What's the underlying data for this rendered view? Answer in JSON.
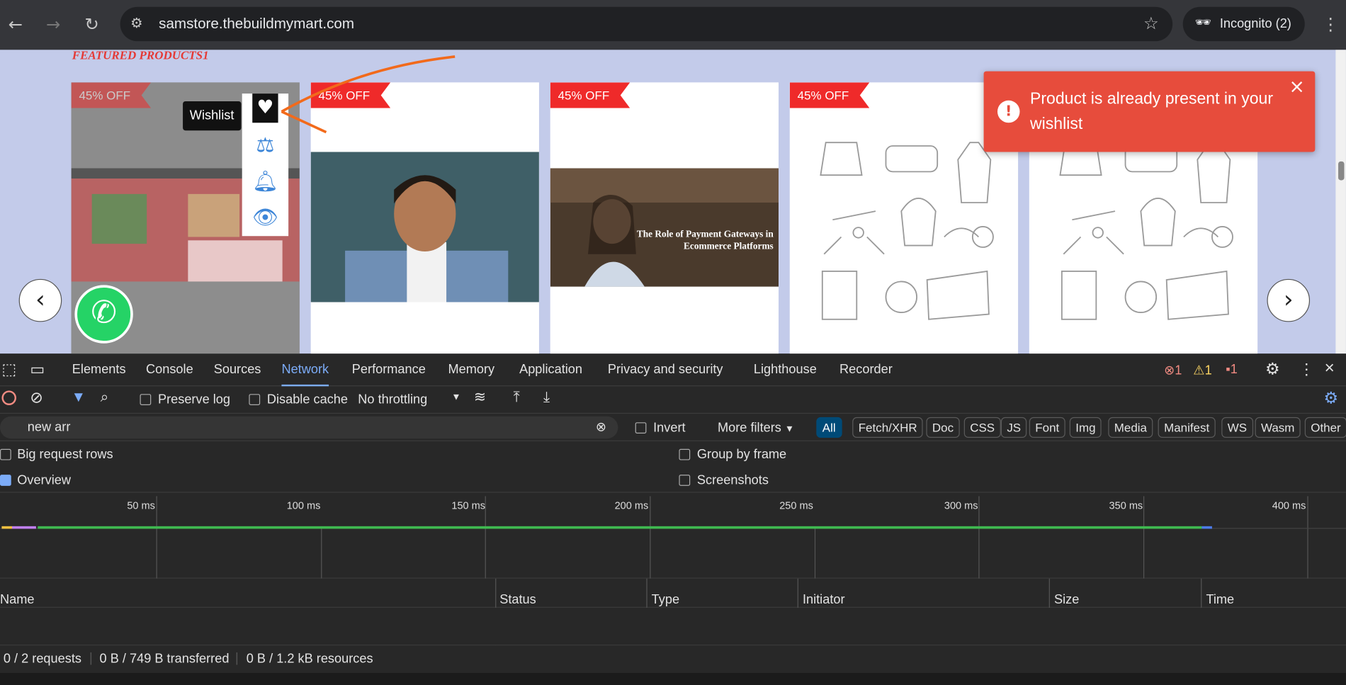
{
  "browser": {
    "url": "samstore.thebuildmymart.com",
    "profile": "Incognito (2)"
  },
  "page": {
    "section_title": "FEATURED PRODUCTS1",
    "cards": [
      {
        "badge": "45% OFF"
      },
      {
        "badge": "45% OFF"
      },
      {
        "badge": "45% OFF"
      },
      {
        "badge": "45% OFF"
      }
    ],
    "card2_caption": "The Role of Payment Gateways in Ecommerce Platforms",
    "wishlist_tooltip": "Wishlist",
    "toast": {
      "message": "Product is already present in your wishlist",
      "color": "#e74c3c"
    },
    "accent": "#ef2a2a"
  },
  "devtools": {
    "tabs": [
      "Elements",
      "Console",
      "Sources",
      "Network",
      "Performance",
      "Memory",
      "Application",
      "Privacy and security",
      "Lighthouse",
      "Recorder"
    ],
    "active_tab": "Network",
    "status": {
      "errors": "1",
      "warnings": "1",
      "issues": "1"
    },
    "preserve_log": "Preserve log",
    "disable_cache": "Disable cache",
    "throttling": "No throttling",
    "filter_value": "new arr",
    "invert": "Invert",
    "more_filters": "More filters",
    "types": [
      "All",
      "Fetch/XHR",
      "Doc",
      "CSS",
      "JS",
      "Font",
      "Img",
      "Media",
      "Manifest",
      "WS",
      "Wasm",
      "Other"
    ],
    "opt_big_rows": "Big request rows",
    "opt_overview": "Overview",
    "opt_group": "Group by frame",
    "opt_screens": "Screenshots",
    "ticks": [
      "50 ms",
      "100 ms",
      "150 ms",
      "200 ms",
      "250 ms",
      "300 ms",
      "350 ms",
      "400 ms"
    ],
    "columns": [
      "Name",
      "Status",
      "Type",
      "Initiator",
      "Size",
      "Time"
    ],
    "summary": {
      "requests": "0 / 2 requests",
      "transferred": "0 B / 749 B transferred",
      "resources": "0 B / 1.2 kB resources"
    }
  }
}
